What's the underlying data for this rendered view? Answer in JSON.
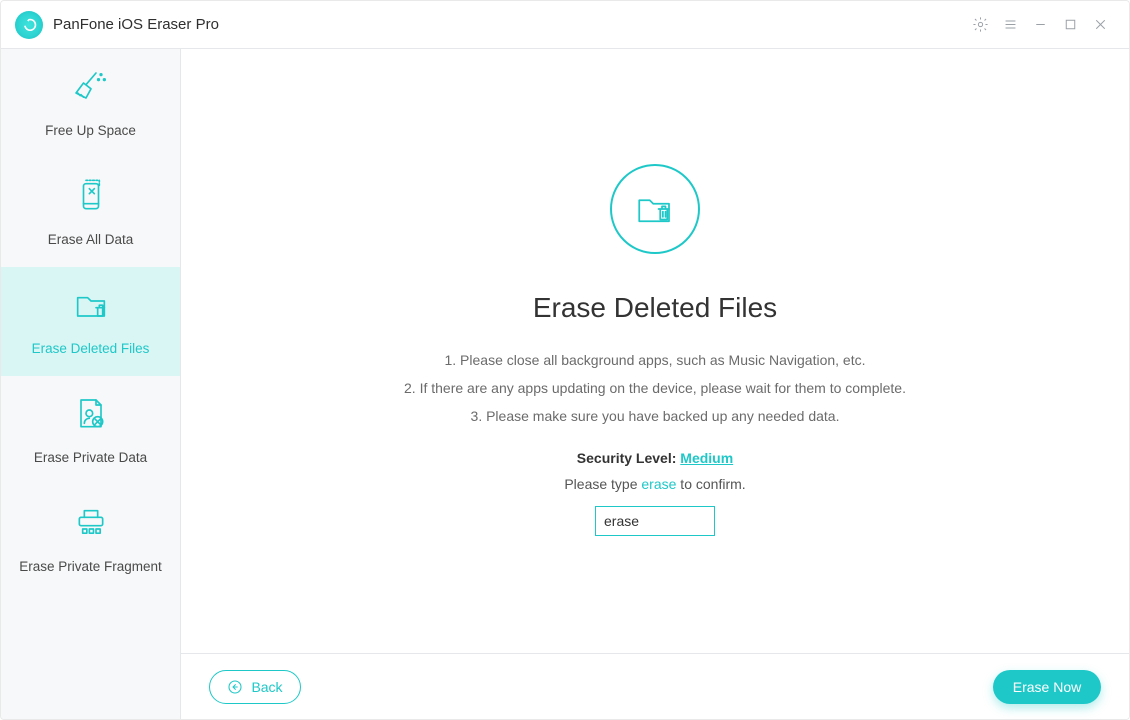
{
  "app": {
    "title": "PanFone iOS Eraser Pro"
  },
  "sidebar": {
    "items": [
      {
        "label": "Free Up Space"
      },
      {
        "label": "Erase All Data"
      },
      {
        "label": "Erase Deleted Files"
      },
      {
        "label": "Erase Private Data"
      },
      {
        "label": "Erase Private Fragment"
      }
    ],
    "selected_index": 2
  },
  "page": {
    "title": "Erase Deleted Files",
    "instructions": [
      "1. Please close all background apps, such as Music Navigation, etc.",
      "2. If there are any apps updating on the device, please wait for them to complete.",
      "3. Please make sure you have backed up any needed data."
    ],
    "security": {
      "label": "Security Level:",
      "level": "Medium"
    },
    "confirm": {
      "prefix": "Please type ",
      "keyword": "erase",
      "suffix": " to confirm.",
      "input_value": "erase"
    }
  },
  "footer": {
    "back_label": "Back",
    "primary_label": "Erase Now"
  }
}
